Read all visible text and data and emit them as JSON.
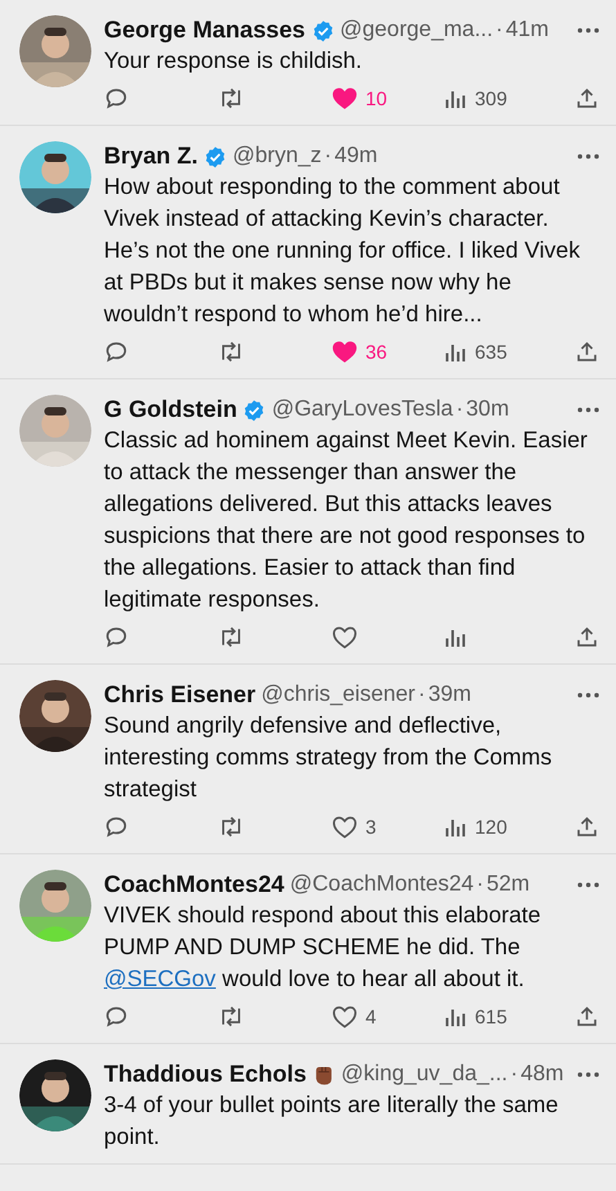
{
  "replies": [
    {
      "name": "George Manasses",
      "badge": {
        "kind": "verified"
      },
      "handle": "@george_ma...",
      "separator": "·",
      "time": "41m",
      "body": [
        {
          "kind": "plain",
          "text": "Your response is childish."
        }
      ],
      "likes": {
        "liked": true,
        "count": "10"
      },
      "views": "309"
    },
    {
      "name": "Bryan Z.",
      "badge": {
        "kind": "verified"
      },
      "handle": "@bryn_z",
      "separator": "·",
      "time": "49m",
      "body": [
        {
          "kind": "plain",
          "text": "How about responding to the comment about Vivek instead of attacking Kevin’s character. He’s not the one running for office. I liked Vivek at PBDs but it makes sense now why he wouldn’t respond to whom he’d hire..."
        }
      ],
      "likes": {
        "liked": true,
        "count": "36"
      },
      "views": "635"
    },
    {
      "name": "G Goldstein",
      "badge": {
        "kind": "verified"
      },
      "handle": "@GaryLovesTesla",
      "separator": "·",
      "time": "30m",
      "body": [
        {
          "kind": "plain",
          "text": "Classic ad hominem against Meet Kevin. Easier to attack the messenger than answer the allegations delivered. But this attacks leaves suspicions that there are not good responses to the allegations. Easier to attack than find legitimate responses."
        }
      ],
      "likes": {
        "liked": false
      }
    },
    {
      "name": "Chris Eisener",
      "handle": "@chris_eisener",
      "separator": "·",
      "time": "39m",
      "body": [
        {
          "kind": "plain",
          "text": "Sound angrily defensive and deflective, interesting comms strategy from the Comms strategist"
        }
      ],
      "likes": {
        "liked": false,
        "count": "3"
      },
      "views": "120"
    },
    {
      "name": "CoachMontes24",
      "handle": "@CoachMontes24",
      "separator": "·",
      "time": "52m",
      "body": [
        {
          "kind": "plain",
          "text": "VIVEK should respond about this elaborate PUMP AND DUMP SCHEME he did. The "
        },
        {
          "kind": "mention",
          "text": "@SECGov"
        },
        {
          "kind": "plain",
          "text": " would love to hear all about it."
        }
      ],
      "likes": {
        "liked": false,
        "count": "4"
      },
      "views": "615"
    },
    {
      "name": "Thaddious Echols",
      "badge": {
        "kind": "fist"
      },
      "handle": "@king_uv_da_...",
      "separator": "·",
      "time": "48m",
      "body": [
        {
          "kind": "plain",
          "text": "3-4 of your bullet points are literally the same point."
        }
      ]
    }
  ]
}
